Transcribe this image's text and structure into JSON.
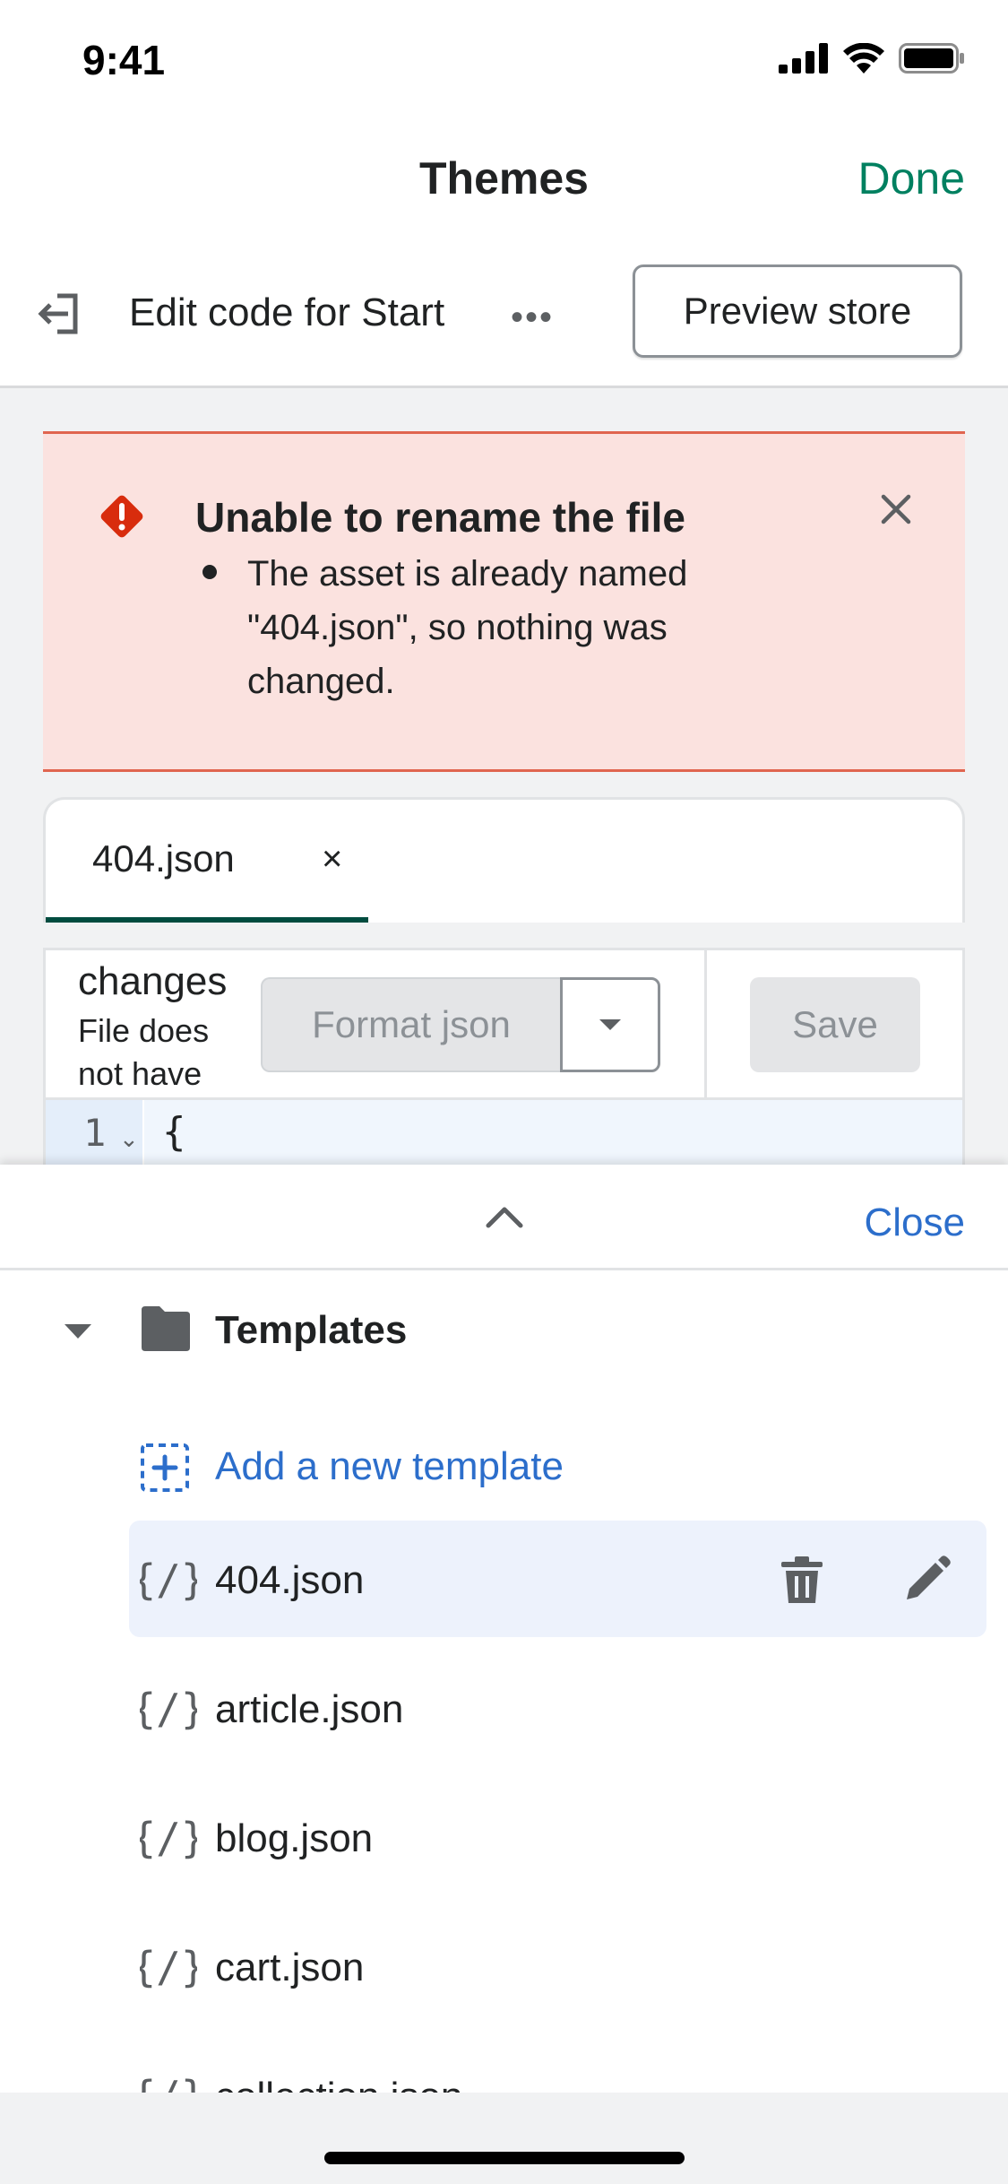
{
  "status_bar": {
    "time": "9:41"
  },
  "nav": {
    "title": "Themes",
    "done_label": "Done"
  },
  "edit_bar": {
    "title": "Edit code for Start",
    "more_label": "•••",
    "preview_label": "Preview store"
  },
  "error_banner": {
    "title": "Unable to rename the file",
    "message": "The asset is already named \"404.json\", so nothing was changed.",
    "color": "#fbe2df"
  },
  "editor": {
    "tab_label": "404.json",
    "tab_close": "×",
    "changes_label": "changes",
    "file_status": "File does not have",
    "format_label": "Format json",
    "save_label": "Save",
    "line_number": "1",
    "fold_marker": "⌄",
    "code_line": "{"
  },
  "sheet": {
    "close_label": "Close",
    "folder_label": "Templates",
    "add_label": "Add a new template",
    "files": [
      "404.json",
      "article.json",
      "blog.json",
      "cart.json",
      "collection.json"
    ],
    "selected_file": "404.json"
  },
  "colors": {
    "accent_green": "#008060",
    "link_blue": "#2c6ecb",
    "selected_row": "#edf2fc"
  }
}
